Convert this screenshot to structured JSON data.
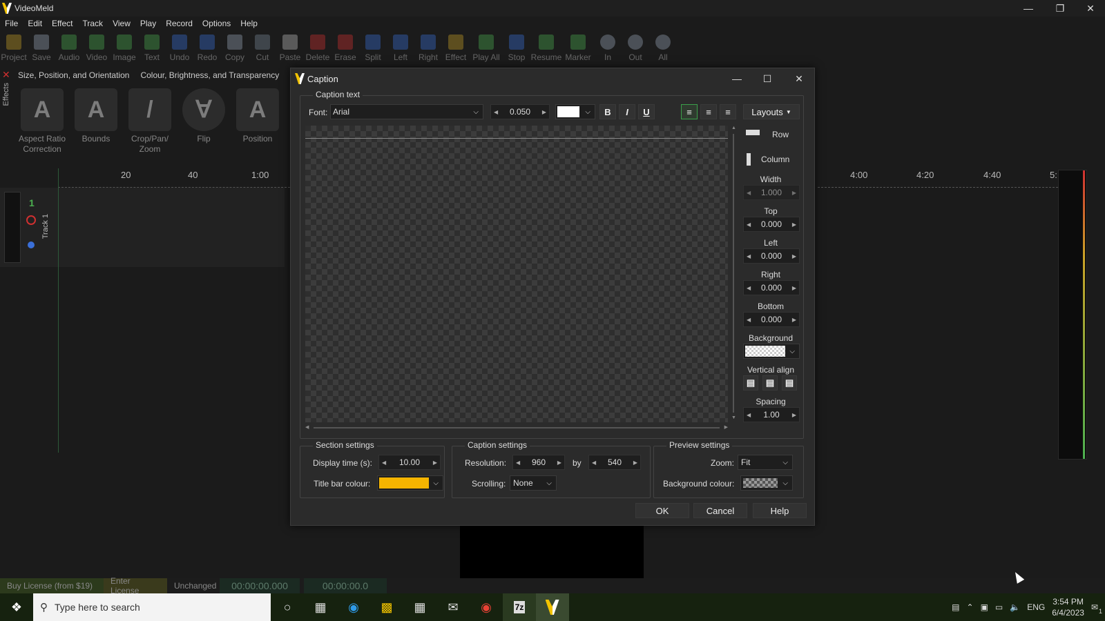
{
  "app": {
    "title": "VideoMeld"
  },
  "menu": [
    "File",
    "Edit",
    "Effect",
    "Track",
    "View",
    "Play",
    "Record",
    "Options",
    "Help"
  ],
  "toolbar": [
    "Project",
    "Save",
    "Audio",
    "Video",
    "Image",
    "Text",
    "Undo",
    "Redo",
    "Copy",
    "Cut",
    "Paste",
    "Delete",
    "Erase",
    "Split",
    "Left",
    "Right",
    "Effect",
    "Play All",
    "Stop",
    "Resume",
    "Marker",
    "In",
    "Out",
    "All"
  ],
  "effects_panel": {
    "side_label": "Effects",
    "tabs": [
      "Size, Position, and Orientation",
      "Colour, Brightness, and Transparency"
    ],
    "items": [
      "Aspect Ratio Correction",
      "Bounds",
      "Crop/Pan/ Zoom",
      "Flip",
      "Position"
    ]
  },
  "ruler": {
    "left": [
      "20",
      "40",
      "1:00"
    ],
    "right": [
      "4:00",
      "4:20",
      "4:40",
      "5:"
    ]
  },
  "track": {
    "number": "1",
    "label": "Track 1"
  },
  "dialog": {
    "title": "Caption",
    "caption_text_group": "Caption text",
    "font_label": "Font:",
    "font_value": "Arial",
    "size_value": "0.050",
    "bold": "B",
    "italic": "I",
    "underline": "U",
    "layouts_label": "Layouts",
    "right_panel": {
      "row": "Row",
      "column": "Column",
      "width_label": "Width",
      "width_value": "1.000",
      "top_label": "Top",
      "top_value": "0.000",
      "left_label": "Left",
      "left_value": "0.000",
      "right_label": "Right",
      "right_value": "0.000",
      "bottom_label": "Bottom",
      "bottom_value": "0.000",
      "background_label": "Background",
      "valign_label": "Vertical align",
      "spacing_label": "Spacing",
      "spacing_value": "1.00"
    },
    "section_settings": {
      "title": "Section settings",
      "display_time_label": "Display time (s):",
      "display_time_value": "10.00",
      "title_bar_colour_label": "Title bar colour:",
      "title_bar_colour": "#f5b400"
    },
    "caption_settings": {
      "title": "Caption settings",
      "resolution_label": "Resolution:",
      "res_w": "960",
      "by": "by",
      "res_h": "540",
      "scrolling_label": "Scrolling:",
      "scrolling_value": "None"
    },
    "preview_settings": {
      "title": "Preview settings",
      "zoom_label": "Zoom:",
      "zoom_value": "Fit",
      "bg_colour_label": "Background colour:"
    },
    "buttons": {
      "ok": "OK",
      "cancel": "Cancel",
      "help": "Help"
    }
  },
  "statusbar": {
    "buy": "Buy License (from $19)",
    "enter": "Enter License",
    "state": "Unchanged",
    "time1": "00:00:00.000",
    "time2": "00:00:00.0"
  },
  "taskbar": {
    "search_placeholder": "Type here to search",
    "lang": "ENG",
    "time": "3:54 PM",
    "date": "6/4/2023",
    "notif_count": "1"
  }
}
